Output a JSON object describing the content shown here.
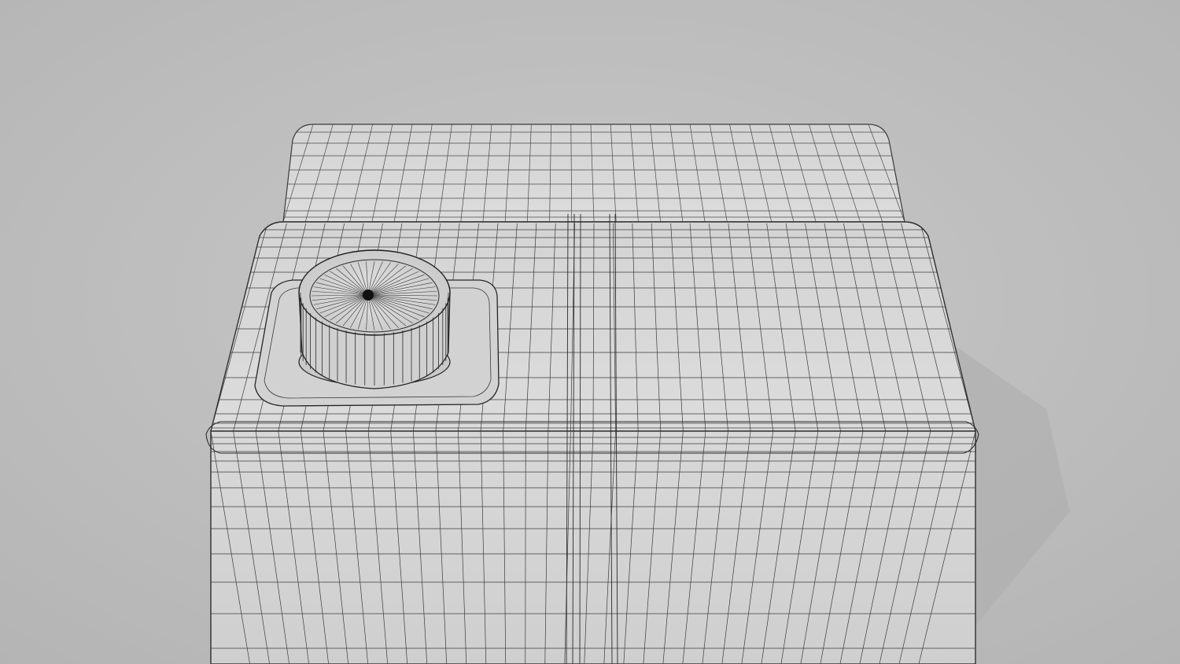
{
  "scene": {
    "subject": "wireframe-canister-render",
    "colors": {
      "background": "#b9b9b9",
      "background_light": "#c6c6c6",
      "surface": "#d7d7d7",
      "surface_shade": "#c4c4c4",
      "wire": "#3a3a3a",
      "wire_dense": "#1e1e1e",
      "shadow": "#a9a9a9"
    },
    "icons": [
      "cap-icon"
    ]
  }
}
